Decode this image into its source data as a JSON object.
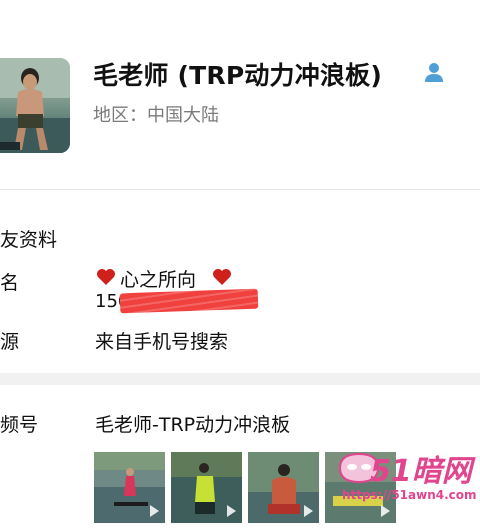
{
  "profile": {
    "display_name": "毛老师 (TRP动力冲浪板)",
    "region": "地区：中国大陆"
  },
  "friend_info": {
    "section_title": "友资料",
    "remark_label": "名",
    "remark_text": "心之所向",
    "phone_prefix": "150",
    "source_label": "源",
    "source_value": "来自手机号搜索"
  },
  "channels": {
    "label": "频号",
    "name": "毛老师-TRP动力冲浪板"
  },
  "watermark": {
    "brand": "51暗网",
    "url": "https://51awn4.com"
  },
  "colors": {
    "accent_blue": "#4d9fd6",
    "heart_red": "#d0201c",
    "watermark_pink": "#e0458d"
  },
  "icons": {
    "contact": "contact-person-icon",
    "heart": "heart-icon",
    "play": "play-icon"
  }
}
